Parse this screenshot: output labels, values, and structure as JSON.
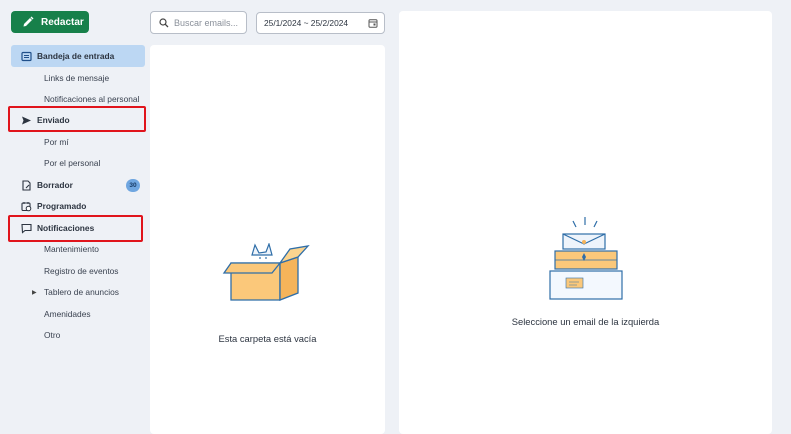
{
  "compose": {
    "label": "Redactar",
    "icon": "pencil-icon"
  },
  "sidebar": {
    "items": [
      {
        "label": "Bandeja de entrada",
        "icon": "inbox-icon",
        "level": "main",
        "active": true
      },
      {
        "label": "Links de mensaje",
        "level": "sub"
      },
      {
        "label": "Notificaciones al personal",
        "level": "sub"
      },
      {
        "label": "Enviado",
        "icon": "send-icon",
        "level": "main",
        "highlighted": true
      },
      {
        "label": "Por mí",
        "level": "sub"
      },
      {
        "label": "Por el personal",
        "level": "sub"
      },
      {
        "label": "Borrador",
        "icon": "draft-icon",
        "level": "main",
        "badge": "30"
      },
      {
        "label": "Programado",
        "icon": "calendar-clock-icon",
        "level": "main"
      },
      {
        "label": "Notificaciones",
        "icon": "chat-icon",
        "level": "main",
        "highlighted": true
      },
      {
        "label": "Mantenimiento",
        "level": "sub"
      },
      {
        "label": "Registro de eventos",
        "level": "sub"
      },
      {
        "label": "Tablero de anuncios",
        "level": "sub",
        "expandable": true
      },
      {
        "label": "Amenidades",
        "level": "sub"
      },
      {
        "label": "Otro",
        "level": "sub"
      }
    ]
  },
  "search": {
    "placeholder": "Buscar emails..."
  },
  "date_range": {
    "value": "25/1/2024 ~ 25/2/2024"
  },
  "list_panel": {
    "empty_text": "Esta carpeta está vacía"
  },
  "detail_panel": {
    "empty_text": "Seleccione un email de la izquierda"
  },
  "colors": {
    "accent": "#17804a",
    "active_bg": "#bcd7f3",
    "highlight": "#e0141c",
    "badge": "#6fa6e0"
  }
}
